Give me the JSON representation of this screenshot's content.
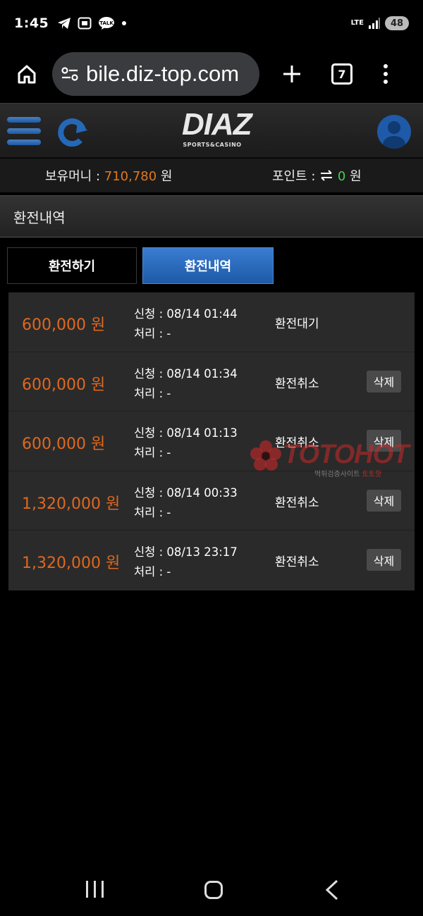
{
  "status_bar": {
    "time": "1:45",
    "network": "LTE",
    "battery": "48"
  },
  "browser": {
    "url": "bile.diz-top.com",
    "tab_count": "7"
  },
  "site": {
    "logo": "DIAZ",
    "logo_sub": "SPORTS&CASINO"
  },
  "balance": {
    "money_label": "보유머니 : ",
    "money_value": "710,780",
    "money_unit": " 원",
    "point_label": "포인트 : ",
    "point_value": "0",
    "point_unit": " 원"
  },
  "section_title": "환전내역",
  "tabs": {
    "exchange": "환전하기",
    "history": "환전내역"
  },
  "history": [
    {
      "amount": "600,000 원",
      "request": "신청 : 08/14 01:44",
      "process": "처리 : -",
      "status": "환전대기",
      "delete": ""
    },
    {
      "amount": "600,000 원",
      "request": "신청 : 08/14 01:34",
      "process": "처리 : -",
      "status": "환전취소",
      "delete": "삭제"
    },
    {
      "amount": "600,000 원",
      "request": "신청 : 08/14 01:13",
      "process": "처리 : -",
      "status": "환전취소",
      "delete": "삭제"
    },
    {
      "amount": "1,320,000 원",
      "request": "신청 : 08/14 00:33",
      "process": "처리 : -",
      "status": "환전취소",
      "delete": "삭제"
    },
    {
      "amount": "1,320,000 원",
      "request": "신청 : 08/13 23:17",
      "process": "처리 : -",
      "status": "환전취소",
      "delete": "삭제"
    }
  ],
  "watermark": {
    "text": "TOTOHOT",
    "sub": "먹튀검증사이트 ",
    "sub_red": "토토핫"
  },
  "colors": {
    "amount": "#e0681f",
    "money": "#e0781f",
    "point": "#3fd34a",
    "accent": "#1d5aa8"
  }
}
